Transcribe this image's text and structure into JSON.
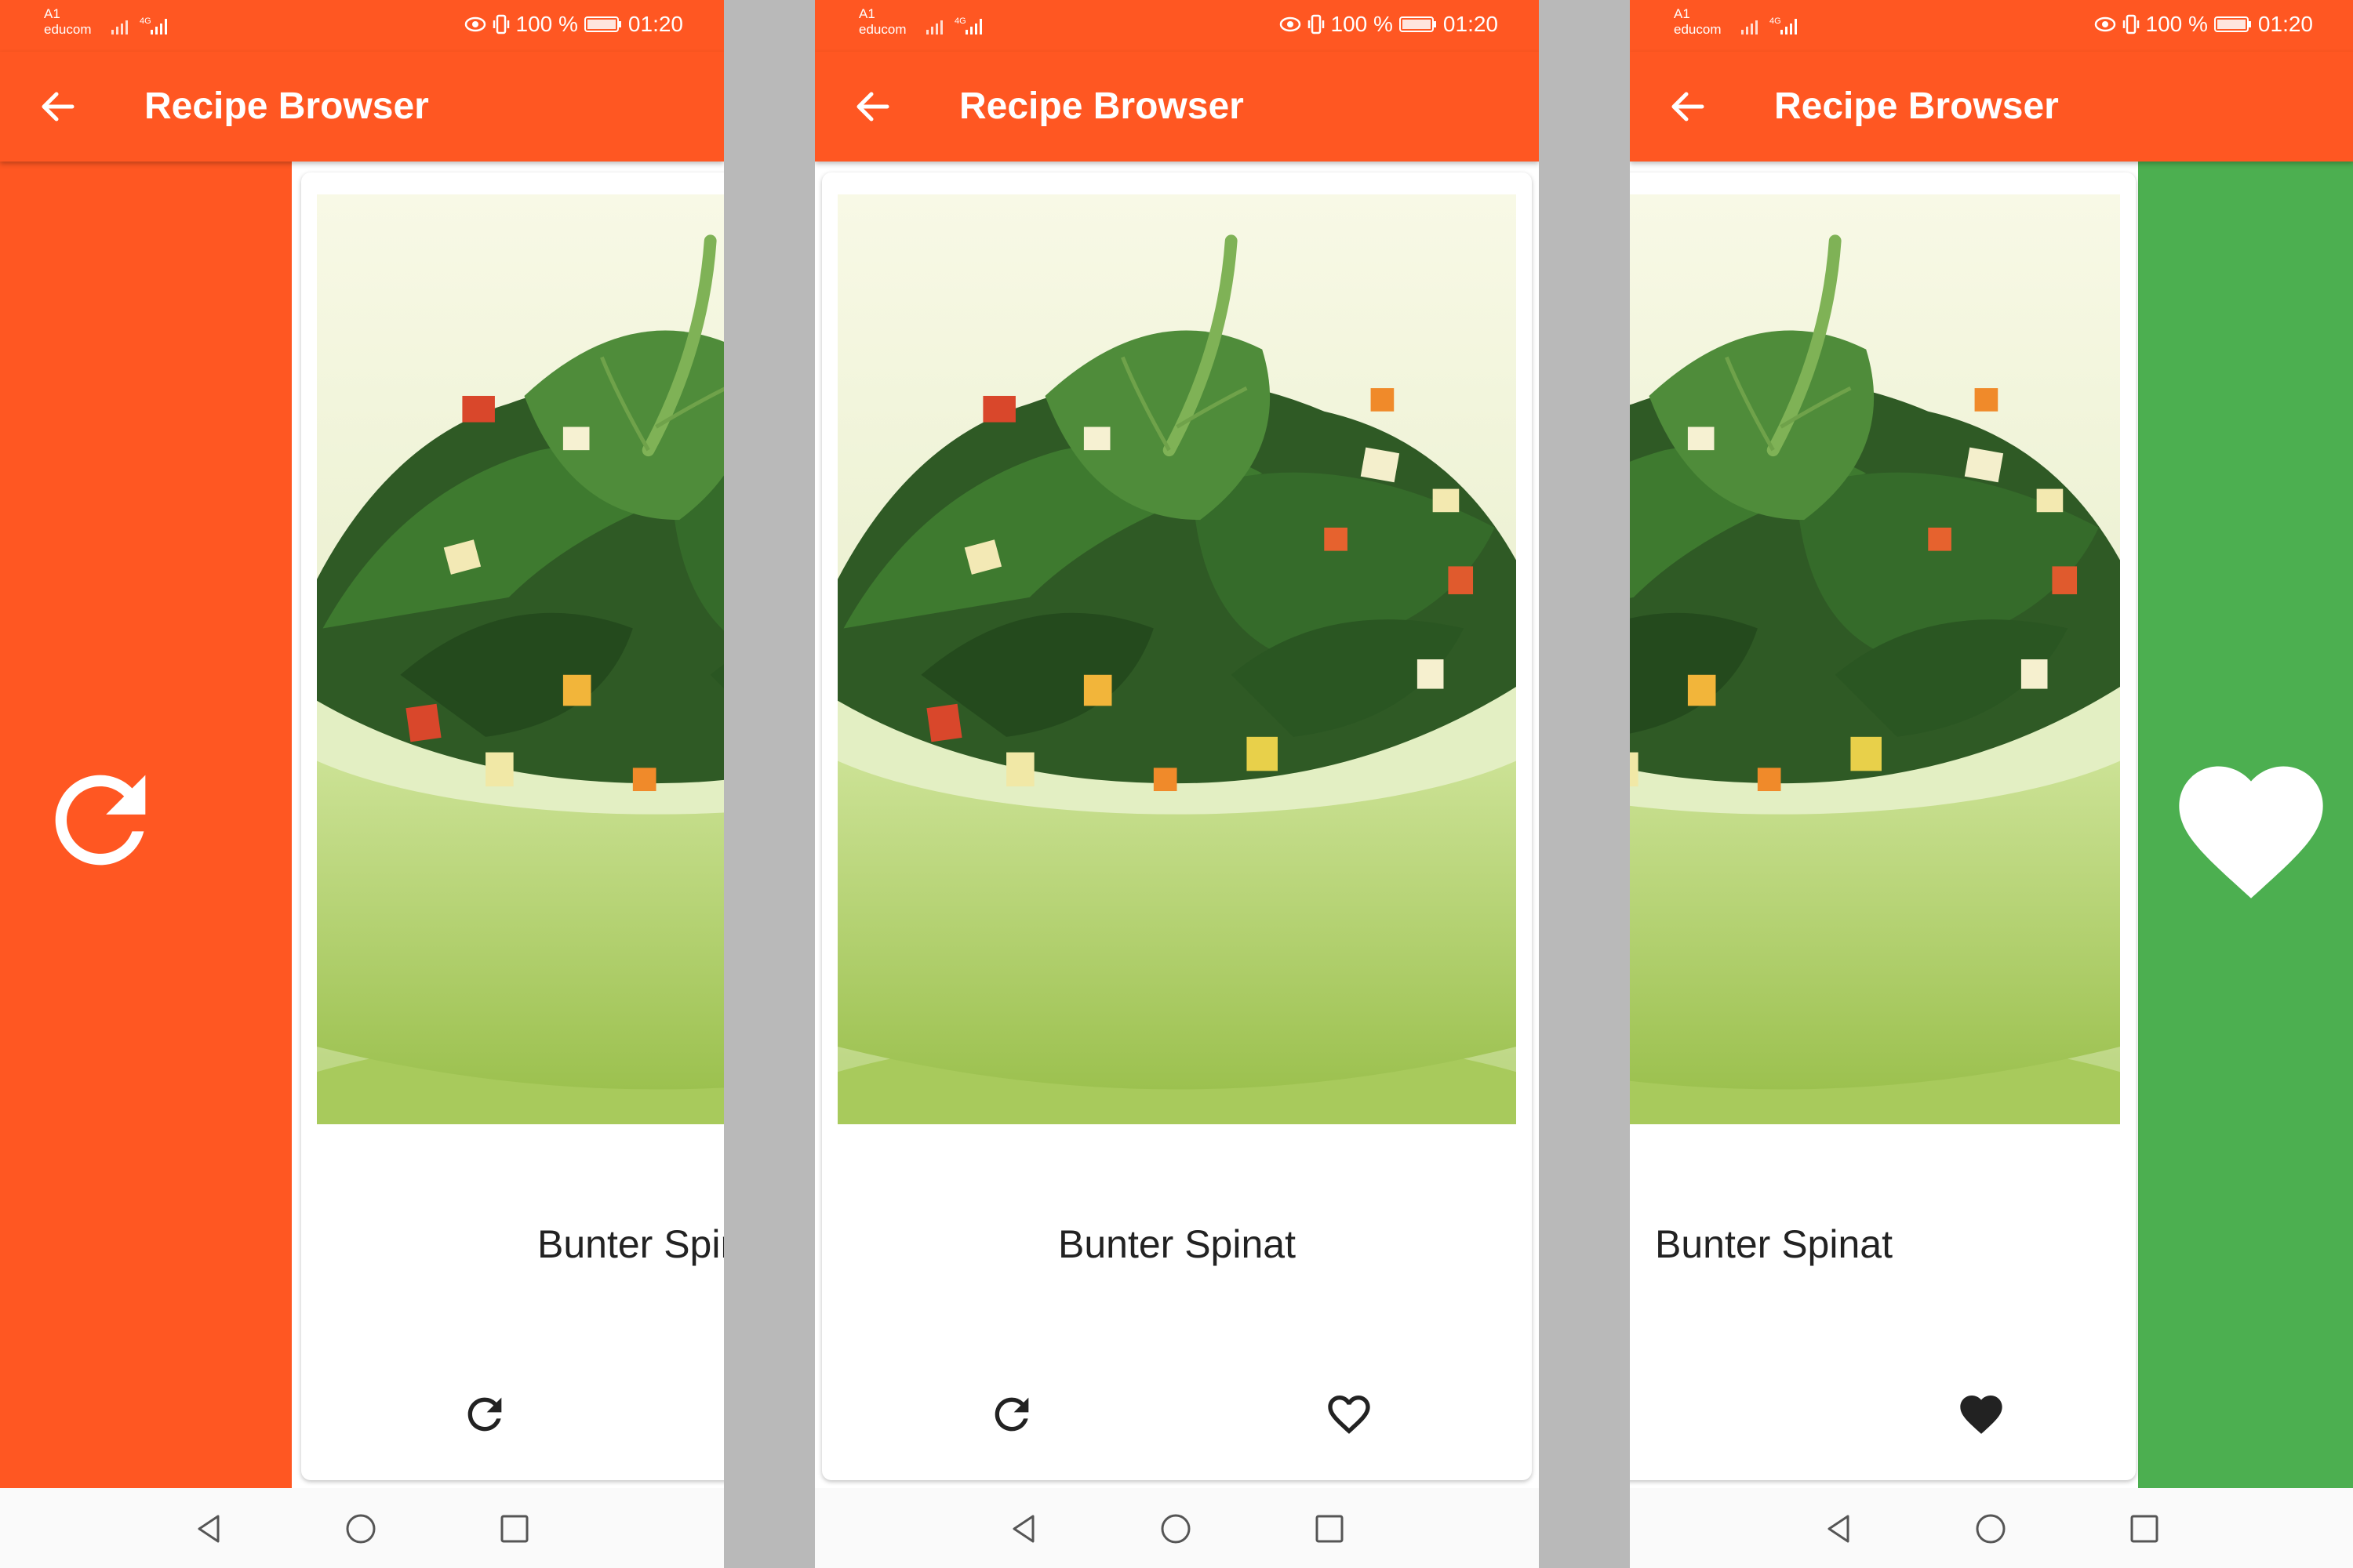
{
  "app": {
    "title": "Recipe Browser"
  },
  "status_bar": {
    "carrier_line1": "A1",
    "carrier_line2": "educom",
    "network": "4G",
    "battery": "100 %",
    "time": "01:20"
  },
  "recipe": {
    "name": "Bunter Spinat"
  },
  "colors": {
    "accent": "#ff5722",
    "like": "#4caf50",
    "separator": "#b9b9b9"
  },
  "screens": [
    {
      "state": "swiping-right-reload",
      "swipe_action_icon": "reload-icon",
      "swipe_color": "#ff5722"
    },
    {
      "state": "idle",
      "buttons": [
        "reload-icon",
        "heart-outline-icon"
      ]
    },
    {
      "state": "swiping-left-like",
      "swipe_action_icon": "heart-filled-icon",
      "swipe_color": "#4caf50"
    }
  ],
  "navbar": {
    "icons": [
      "back-triangle-icon",
      "home-circle-icon",
      "recent-square-icon"
    ]
  }
}
